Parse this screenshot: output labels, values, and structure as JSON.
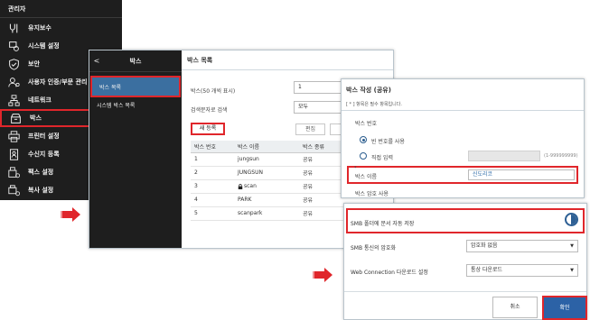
{
  "colors": {
    "accent": "#2c62a6",
    "highlight": "#e0262b",
    "dark_bg": "#1e1e1e",
    "arrow": "#e0262b"
  },
  "admin_sidebar": {
    "header": "관리자",
    "items": [
      {
        "label": "유지보수",
        "icon": "maintenance-icon"
      },
      {
        "label": "시스템 설정",
        "icon": "system-settings-icon"
      },
      {
        "label": "보안",
        "icon": "shield-icon"
      },
      {
        "label": "사용자 인증/부문 관리",
        "icon": "user-auth-icon"
      },
      {
        "label": "네트워크",
        "icon": "network-icon"
      },
      {
        "label": "박스",
        "icon": "box-icon",
        "active": true
      },
      {
        "label": "프린터 설정",
        "icon": "printer-icon"
      },
      {
        "label": "수신지 등록",
        "icon": "address-book-icon"
      },
      {
        "label": "팩스 설정",
        "icon": "fax-icon"
      },
      {
        "label": "복사 설정",
        "icon": "copy-icon"
      }
    ]
  },
  "box_list": {
    "sidebar": {
      "back": "<",
      "title": "박스",
      "menu": [
        {
          "label": "박스 목록",
          "active": true
        },
        {
          "label": "시스템 박스 목록"
        }
      ]
    },
    "title": "박스 목록",
    "display_count_label": "박스(50 개씩 표시)",
    "display_count_value": "1",
    "search_label": "검색문자로 검색",
    "search_value": "모두",
    "new_button": "새 등록",
    "edit_button": "편집",
    "delete_button": "삭",
    "table": {
      "headers": [
        "박스 번호",
        "박스 이름",
        "박스 종류"
      ],
      "rows": [
        {
          "number": "1",
          "name": "jungsun",
          "type": "공유",
          "locked": false
        },
        {
          "number": "2",
          "name": "JUNGSUN",
          "type": "공유",
          "locked": false
        },
        {
          "number": "3",
          "name": "scan",
          "type": "공유",
          "locked": true
        },
        {
          "number": "4",
          "name": "PARK",
          "type": "공유",
          "locked": false
        },
        {
          "number": "5",
          "name": "scanpark",
          "type": "공유",
          "locked": false
        }
      ]
    }
  },
  "create_dialog": {
    "title": "박스 작성 (공유)",
    "note": "[ * ] 항목은 필수 항목입니다.",
    "box_number_label": "박스 번호",
    "radio_empty": "빈 번호를 사용",
    "radio_direct": "직접 입력",
    "number_range": "(1-999999999)",
    "required_mark": "*",
    "box_name_label": "박스 이름",
    "box_name_value": "신도리코",
    "password_label": "박스 암호 사용"
  },
  "smb_settings": {
    "smb_auto_save_label": "SMB 폴더에 문서 자동 저장",
    "smb_auto_save_on": true,
    "smb_encrypt_label": "SMB 통신의 암호화",
    "smb_encrypt_value": "암호화 없음",
    "web_download_label": "Web Connection 다운로드 설정",
    "web_download_value": "통상 다운로드",
    "cancel_button": "취소",
    "ok_button": "확인"
  }
}
